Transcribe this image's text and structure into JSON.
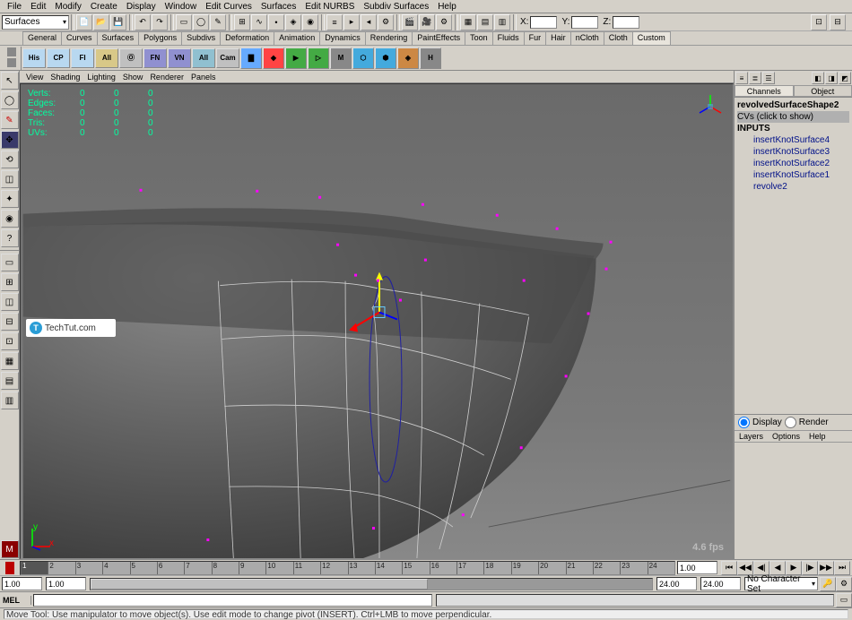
{
  "menubar": [
    "File",
    "Edit",
    "Modify",
    "Create",
    "Display",
    "Window",
    "Edit Curves",
    "Surfaces",
    "Edit NURBS",
    "Subdiv Surfaces",
    "Help"
  ],
  "module_dropdown": "Surfaces",
  "coord_labels": {
    "x": "X:",
    "y": "Y:",
    "z": "Z:"
  },
  "shelf_tabs": [
    "General",
    "Curves",
    "Surfaces",
    "Polygons",
    "Subdivs",
    "Deformation",
    "Animation",
    "Dynamics",
    "Rendering",
    "PaintEffects",
    "Toon",
    "Fluids",
    "Fur",
    "Hair",
    "nCloth",
    "Cloth",
    "Custom"
  ],
  "shelf_active": "Custom",
  "shelf_buttons": [
    "His",
    "CP",
    "FI",
    "All",
    "Ⓞ",
    "FN",
    "VN",
    "All",
    "Cam"
  ],
  "view_menu": [
    "View",
    "Shading",
    "Lighting",
    "Show",
    "Renderer",
    "Panels"
  ],
  "hud": {
    "rows": [
      {
        "label": "Verts:",
        "v1": "0",
        "v2": "0",
        "v3": "0"
      },
      {
        "label": "Edges:",
        "v1": "0",
        "v2": "0",
        "v3": "0"
      },
      {
        "label": "Faces:",
        "v1": "0",
        "v2": "0",
        "v3": "0"
      },
      {
        "label": "Tris:",
        "v1": "0",
        "v2": "0",
        "v3": "0"
      },
      {
        "label": "UVs:",
        "v1": "0",
        "v2": "0",
        "v3": "0"
      }
    ]
  },
  "fps": "4.6 fps",
  "watermark": "TechTut.com",
  "right": {
    "tabs": [
      "Channels",
      "Object"
    ],
    "active": "Channels",
    "node": "revolvedSurfaceShape2",
    "cvs": "CVs (click to show)",
    "section": "INPUTS",
    "inputs": [
      "insertKnotSurface4",
      "insertKnotSurface3",
      "insertKnotSurface2",
      "insertKnotSurface1",
      "revolve2"
    ],
    "radio": {
      "display": "Display",
      "render": "Render"
    },
    "menu2": [
      "Layers",
      "Options",
      "Help"
    ]
  },
  "time": {
    "current": "1.00",
    "ticks": [
      "1",
      "2",
      "3",
      "4",
      "5",
      "6",
      "7",
      "8",
      "9",
      "10",
      "11",
      "12",
      "13",
      "14",
      "15",
      "16",
      "17",
      "18",
      "19",
      "20",
      "21",
      "22",
      "23",
      "24"
    ],
    "end_field": "1.00",
    "range_start": "1.00",
    "range_start2": "1.00",
    "range_end": "24.00",
    "range_end2": "24.00",
    "char_set": "No Character Set"
  },
  "cmd": {
    "label": "MEL"
  },
  "helpline": "Move Tool: Use manipulator to move object(s). Use edit mode to change pivot (INSERT). Ctrl+LMB to move perpendicular."
}
